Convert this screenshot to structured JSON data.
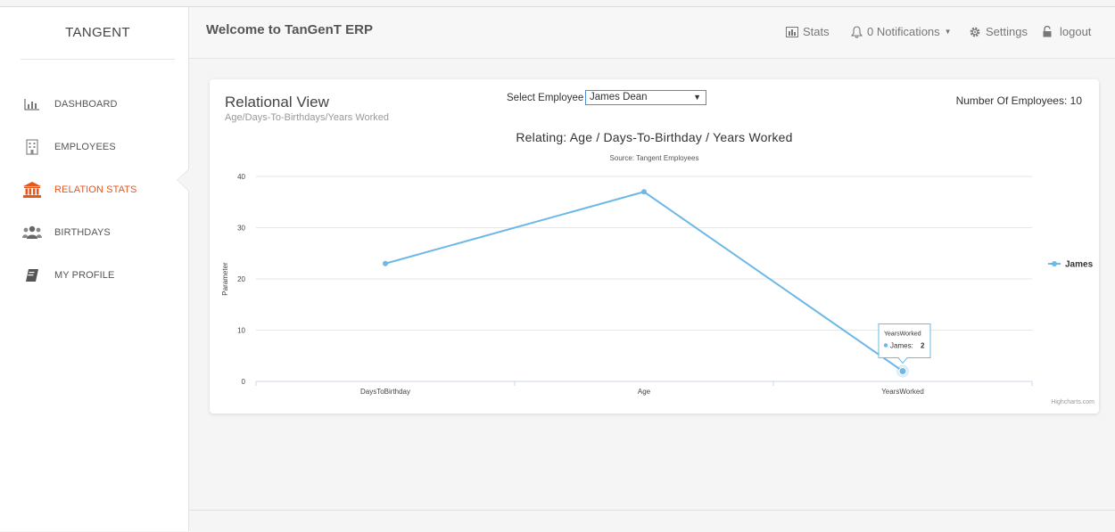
{
  "sidebar": {
    "brand": "TANGENT",
    "items": [
      {
        "label": "DASHBOARD",
        "icon": "bar-chart-icon",
        "active": false
      },
      {
        "label": "EMPLOYEES",
        "icon": "building-icon",
        "active": false
      },
      {
        "label": "RELATION STATS",
        "icon": "bank-icon",
        "active": true
      },
      {
        "label": "BIRTHDAYS",
        "icon": "users-icon",
        "active": false
      },
      {
        "label": "MY PROFILE",
        "icon": "book-icon",
        "active": false
      }
    ]
  },
  "header": {
    "title": "Welcome to TanGenT ERP",
    "stats": "Stats",
    "notifications": "0 Notifications",
    "settings": "Settings",
    "logout": "logout"
  },
  "card": {
    "title": "Relational View",
    "subtitle": "Age/Days-To-Birthdays/Years Worked",
    "select_label": "Select Employee",
    "select_value": "James Dean",
    "employee_count": "Number Of Employees: 10"
  },
  "chart_data": {
    "type": "line",
    "title": "Relating: Age / Days-To-Birthday / Years Worked",
    "subtitle": "Source: Tangent Employees",
    "ylabel": "Parameter",
    "xlabel": "",
    "categories": [
      "DaysToBirthday",
      "Age",
      "YearsWorked"
    ],
    "ylim": [
      0,
      40
    ],
    "yticks": [
      0,
      10,
      20,
      30,
      40
    ],
    "grid": true,
    "legend": "right",
    "series": [
      {
        "name": "James",
        "values": [
          23,
          37,
          2
        ],
        "color": "#6cb8e6"
      }
    ],
    "tooltip": {
      "category": "YearsWorked",
      "series": "James",
      "value": "2"
    },
    "credit": "Highcharts.com"
  },
  "colors": {
    "accent": "#e8561c",
    "series": "#6cb8e6"
  }
}
